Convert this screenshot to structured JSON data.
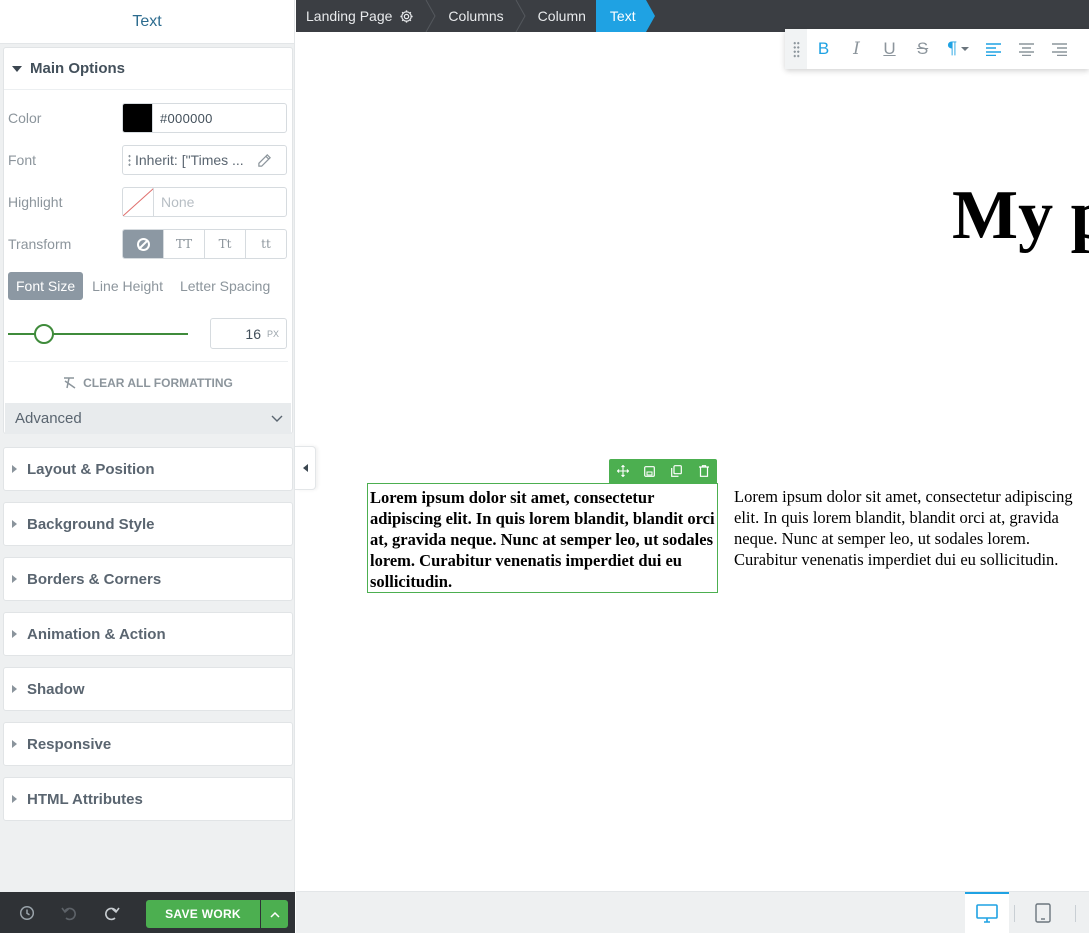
{
  "sidebar": {
    "title": "Text",
    "main_options": {
      "title": "Main Options",
      "color": {
        "label": "Color",
        "value": "#000000",
        "swatch": "#000000"
      },
      "font": {
        "label": "Font",
        "value": "Inherit: [\"Times ..."
      },
      "highlight": {
        "label": "Highlight",
        "value": "None"
      },
      "transform": {
        "label": "Transform",
        "options": [
          "none",
          "TT",
          "Tt",
          "tt"
        ],
        "selected": "none"
      },
      "size_tabs": [
        "Font Size",
        "Line Height",
        "Letter Spacing"
      ],
      "active_size_tab": "Font Size",
      "font_size": {
        "value": "16",
        "unit": "PX",
        "slider_fraction": 0.2
      },
      "clear_all": "CLEAR ALL FORMATTING",
      "advanced": "Advanced"
    },
    "sections": [
      "Layout & Position",
      "Background Style",
      "Borders & Corners",
      "Animation & Action",
      "Shadow",
      "Responsive",
      "HTML Attributes"
    ],
    "footer": {
      "save_label": "SAVE WORK"
    }
  },
  "breadcrumbs": [
    "Landing Page",
    "Columns",
    "Column",
    "Text"
  ],
  "format_toolbar": {
    "buttons": [
      "bold",
      "italic",
      "underline",
      "strikethrough",
      "paragraph",
      "align-left",
      "align-center",
      "align-right"
    ]
  },
  "canvas": {
    "heading": "My p",
    "text_selected": "Lorem ipsum dolor sit amet, consectetur adipiscing elit. In quis lorem blandit, blandit orci at, gravida neque. Nunc at semper leo, ut sodales lorem. Curabitur venenatis imperdiet dui eu sollicitudin.",
    "text_other": "Lorem ipsum dolor sit amet, consectetur adipiscing elit. In quis lorem blandit, blandit orci at, gravida neque. Nunc at semper leo, ut sodales lorem. Curabitur venenatis imperdiet dui eu sollicitudin."
  },
  "colors": {
    "accent": "#1fa2e3",
    "success": "#4caf50",
    "topbar": "#3b3e43"
  },
  "devices": [
    "desktop",
    "tablet"
  ],
  "active_device": "desktop"
}
